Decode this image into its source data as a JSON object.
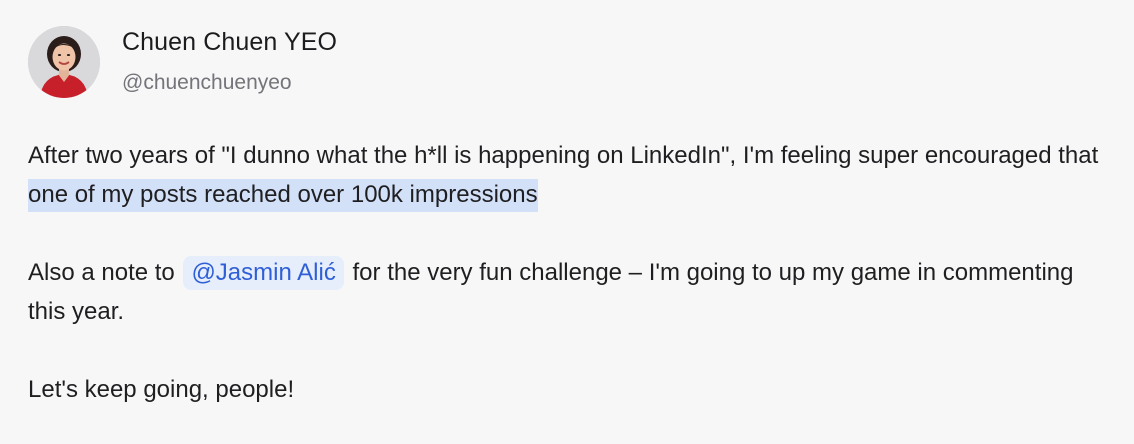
{
  "author": {
    "name": "Chuen Chuen YEO",
    "handle": "@chuenchuenyeo",
    "avatar_icon": "profile-photo"
  },
  "post": {
    "p1_before": "After two years of \"I dunno what the h*ll is happening on LinkedIn\", I'm feeling super encouraged that ",
    "p1_highlight": "one of my posts reached over 100k impressions",
    "p2_before": "Also a note to ",
    "p2_mention": "@Jasmin Alić",
    "p2_after": " for the very fun challenge – I'm going to up my game in commenting this year.",
    "p3": "Let's keep going, people!"
  },
  "colors": {
    "background": "#f7f7f8",
    "highlight": "#d2e0f8",
    "mention_bg": "#e7eefb",
    "mention_text": "#2f5fd6",
    "handle_text": "#74747a"
  }
}
